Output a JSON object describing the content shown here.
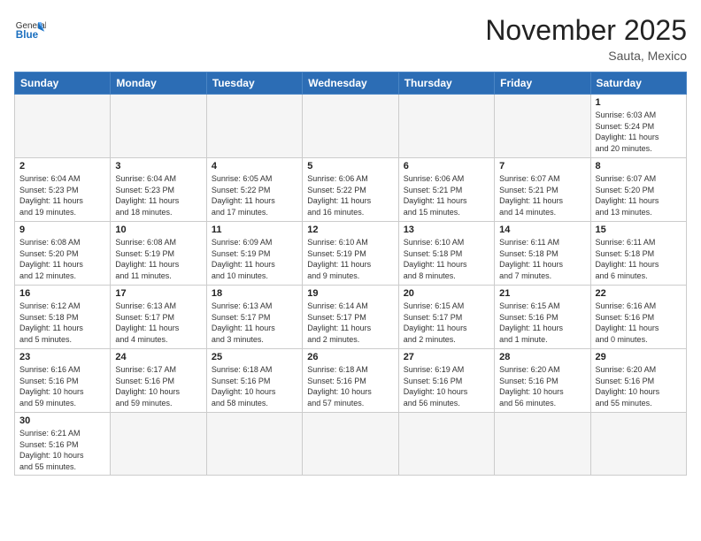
{
  "header": {
    "logo_general": "General",
    "logo_blue": "Blue",
    "title": "November 2025",
    "subtitle": "Sauta, Mexico"
  },
  "days_of_week": [
    "Sunday",
    "Monday",
    "Tuesday",
    "Wednesday",
    "Thursday",
    "Friday",
    "Saturday"
  ],
  "weeks": [
    [
      {
        "day": "",
        "info": ""
      },
      {
        "day": "",
        "info": ""
      },
      {
        "day": "",
        "info": ""
      },
      {
        "day": "",
        "info": ""
      },
      {
        "day": "",
        "info": ""
      },
      {
        "day": "",
        "info": ""
      },
      {
        "day": "1",
        "info": "Sunrise: 6:03 AM\nSunset: 5:24 PM\nDaylight: 11 hours\nand 20 minutes."
      }
    ],
    [
      {
        "day": "2",
        "info": "Sunrise: 6:04 AM\nSunset: 5:23 PM\nDaylight: 11 hours\nand 19 minutes."
      },
      {
        "day": "3",
        "info": "Sunrise: 6:04 AM\nSunset: 5:23 PM\nDaylight: 11 hours\nand 18 minutes."
      },
      {
        "day": "4",
        "info": "Sunrise: 6:05 AM\nSunset: 5:22 PM\nDaylight: 11 hours\nand 17 minutes."
      },
      {
        "day": "5",
        "info": "Sunrise: 6:06 AM\nSunset: 5:22 PM\nDaylight: 11 hours\nand 16 minutes."
      },
      {
        "day": "6",
        "info": "Sunrise: 6:06 AM\nSunset: 5:21 PM\nDaylight: 11 hours\nand 15 minutes."
      },
      {
        "day": "7",
        "info": "Sunrise: 6:07 AM\nSunset: 5:21 PM\nDaylight: 11 hours\nand 14 minutes."
      },
      {
        "day": "8",
        "info": "Sunrise: 6:07 AM\nSunset: 5:20 PM\nDaylight: 11 hours\nand 13 minutes."
      }
    ],
    [
      {
        "day": "9",
        "info": "Sunrise: 6:08 AM\nSunset: 5:20 PM\nDaylight: 11 hours\nand 12 minutes."
      },
      {
        "day": "10",
        "info": "Sunrise: 6:08 AM\nSunset: 5:19 PM\nDaylight: 11 hours\nand 11 minutes."
      },
      {
        "day": "11",
        "info": "Sunrise: 6:09 AM\nSunset: 5:19 PM\nDaylight: 11 hours\nand 10 minutes."
      },
      {
        "day": "12",
        "info": "Sunrise: 6:10 AM\nSunset: 5:19 PM\nDaylight: 11 hours\nand 9 minutes."
      },
      {
        "day": "13",
        "info": "Sunrise: 6:10 AM\nSunset: 5:18 PM\nDaylight: 11 hours\nand 8 minutes."
      },
      {
        "day": "14",
        "info": "Sunrise: 6:11 AM\nSunset: 5:18 PM\nDaylight: 11 hours\nand 7 minutes."
      },
      {
        "day": "15",
        "info": "Sunrise: 6:11 AM\nSunset: 5:18 PM\nDaylight: 11 hours\nand 6 minutes."
      }
    ],
    [
      {
        "day": "16",
        "info": "Sunrise: 6:12 AM\nSunset: 5:18 PM\nDaylight: 11 hours\nand 5 minutes."
      },
      {
        "day": "17",
        "info": "Sunrise: 6:13 AM\nSunset: 5:17 PM\nDaylight: 11 hours\nand 4 minutes."
      },
      {
        "day": "18",
        "info": "Sunrise: 6:13 AM\nSunset: 5:17 PM\nDaylight: 11 hours\nand 3 minutes."
      },
      {
        "day": "19",
        "info": "Sunrise: 6:14 AM\nSunset: 5:17 PM\nDaylight: 11 hours\nand 2 minutes."
      },
      {
        "day": "20",
        "info": "Sunrise: 6:15 AM\nSunset: 5:17 PM\nDaylight: 11 hours\nand 2 minutes."
      },
      {
        "day": "21",
        "info": "Sunrise: 6:15 AM\nSunset: 5:16 PM\nDaylight: 11 hours\nand 1 minute."
      },
      {
        "day": "22",
        "info": "Sunrise: 6:16 AM\nSunset: 5:16 PM\nDaylight: 11 hours\nand 0 minutes."
      }
    ],
    [
      {
        "day": "23",
        "info": "Sunrise: 6:16 AM\nSunset: 5:16 PM\nDaylight: 10 hours\nand 59 minutes."
      },
      {
        "day": "24",
        "info": "Sunrise: 6:17 AM\nSunset: 5:16 PM\nDaylight: 10 hours\nand 59 minutes."
      },
      {
        "day": "25",
        "info": "Sunrise: 6:18 AM\nSunset: 5:16 PM\nDaylight: 10 hours\nand 58 minutes."
      },
      {
        "day": "26",
        "info": "Sunrise: 6:18 AM\nSunset: 5:16 PM\nDaylight: 10 hours\nand 57 minutes."
      },
      {
        "day": "27",
        "info": "Sunrise: 6:19 AM\nSunset: 5:16 PM\nDaylight: 10 hours\nand 56 minutes."
      },
      {
        "day": "28",
        "info": "Sunrise: 6:20 AM\nSunset: 5:16 PM\nDaylight: 10 hours\nand 56 minutes."
      },
      {
        "day": "29",
        "info": "Sunrise: 6:20 AM\nSunset: 5:16 PM\nDaylight: 10 hours\nand 55 minutes."
      }
    ],
    [
      {
        "day": "30",
        "info": "Sunrise: 6:21 AM\nSunset: 5:16 PM\nDaylight: 10 hours\nand 55 minutes."
      },
      {
        "day": "",
        "info": ""
      },
      {
        "day": "",
        "info": ""
      },
      {
        "day": "",
        "info": ""
      },
      {
        "day": "",
        "info": ""
      },
      {
        "day": "",
        "info": ""
      },
      {
        "day": "",
        "info": ""
      }
    ]
  ]
}
